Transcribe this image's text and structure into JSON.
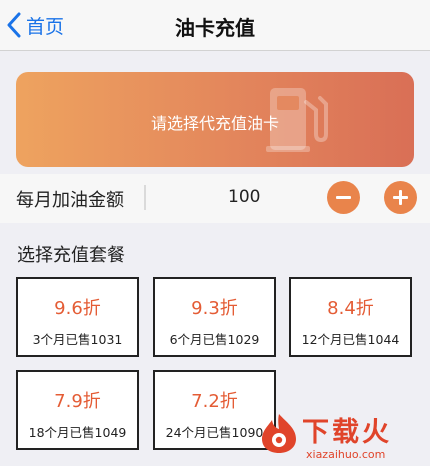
{
  "nav": {
    "back_label": "首页",
    "title": "油卡充值"
  },
  "fuel_card": {
    "prompt": "请选择代充值油卡",
    "icon": "gas-pump-icon"
  },
  "amount": {
    "label": "每月加油金额",
    "value": "100"
  },
  "packages": {
    "title": "选择充值套餐",
    "items": [
      {
        "discount": "9.6折",
        "sold": "3个月已售1031"
      },
      {
        "discount": "9.3折",
        "sold": "6个月已售1029"
      },
      {
        "discount": "8.4折",
        "sold": "12个月已售1044"
      },
      {
        "discount": "7.9折",
        "sold": "18个月已售1049"
      },
      {
        "discount": "7.2折",
        "sold": "24个月已售1090"
      }
    ]
  },
  "watermark": {
    "text": "下载火",
    "sub": "xiazaihuo.com"
  },
  "colors": {
    "accent": "#e9844b",
    "discount": "#e45c35",
    "link": "#1a73e8"
  }
}
